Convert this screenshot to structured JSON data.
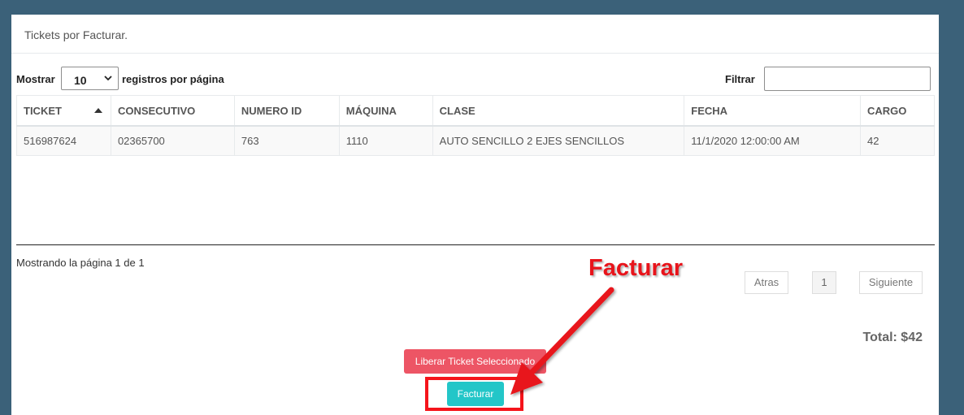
{
  "panel": {
    "title": "Tickets por Facturar."
  },
  "length_menu": {
    "prefix": "Mostrar",
    "value": "10",
    "suffix": "registros por página"
  },
  "filter": {
    "label": "Filtrar",
    "value": ""
  },
  "table": {
    "columns": [
      "TICKET",
      "CONSECUTIVO",
      "NUMERO ID",
      "MÁQUINA",
      "CLASE",
      "FECHA",
      "CARGO"
    ],
    "rows": [
      [
        "516987624",
        "02365700",
        "763",
        "1110",
        "AUTO SENCILLO 2 EJES SENCILLOS",
        "11/1/2020 12:00:00 AM",
        "42"
      ]
    ]
  },
  "info": "Mostrando la página 1 de 1",
  "pagination": {
    "prev": "Atras",
    "current": "1",
    "next": "Siguiente"
  },
  "total": "Total: $42",
  "actions": {
    "release": "Liberar Ticket Seleccionado",
    "bill": "Facturar"
  },
  "annotation": {
    "label": "Facturar",
    "color": "#e8141b"
  }
}
